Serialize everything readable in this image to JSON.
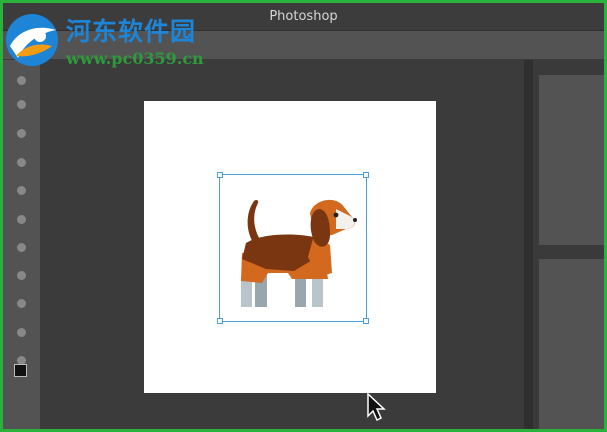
{
  "window": {
    "title": "Photoshop"
  },
  "watermark": {
    "title": "河东软件园",
    "url": "www.pc0359.cn"
  },
  "toolbar": {
    "tool_count": 12
  },
  "canvas": {
    "image": "beagle-dog-illustration"
  },
  "colors": {
    "frame": "#2ab33a",
    "selection": "#4aa0dc",
    "dog_brown": "#d2691e",
    "dog_dark": "#7a3511",
    "dog_leg": "#b9c4cb"
  }
}
